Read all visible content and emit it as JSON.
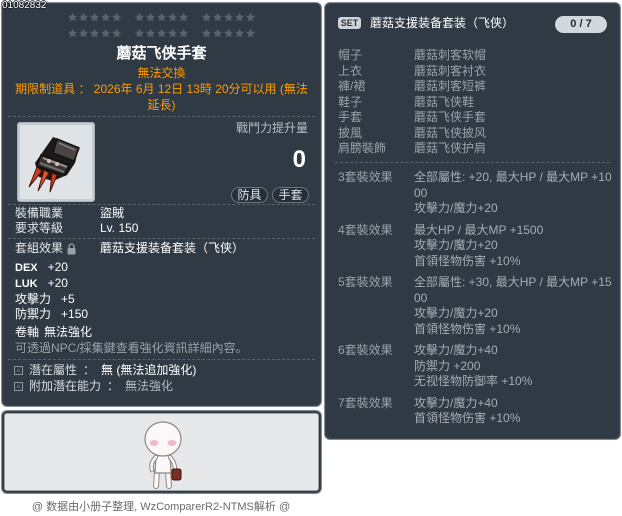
{
  "item_id": "01082832",
  "stars": {
    "total": 30,
    "filled": 0,
    "per_group": 5,
    "groups_per_row": 3
  },
  "colors": {
    "warning": "#ff9c00",
    "dimmed": "#9ba2a8",
    "panel": "#2f3a44"
  },
  "item": {
    "name": "蘑菇飞侠手套",
    "trade": "無法交換",
    "expiry": "期限制道具 ： 2026年 6月 12日 13時 20分可以用 (無法延長)",
    "icon": "glove-icon",
    "power_label": "戰鬥力提升量",
    "power_value": "0",
    "tags": [
      "防具",
      "手套"
    ]
  },
  "requirements": [
    {
      "label": "裝備職業",
      "value": "盜賊"
    },
    {
      "label": "要求等級",
      "value": "Lv. 150"
    }
  ],
  "set_effect": {
    "label": "套組效果",
    "icon": "lock-icon",
    "name": "蘑菇支援装备套装（飞侠）"
  },
  "stats": [
    {
      "label": "DEX",
      "value": "+20"
    },
    {
      "label": "LUK",
      "value": "+20"
    },
    {
      "label": "攻擊力",
      "value": "+5"
    },
    {
      "label": "防禦力",
      "value": "+150"
    }
  ],
  "scroll": {
    "label": "卷軸",
    "value": "無法強化"
  },
  "note": "可透過NPC/採集鍵查看強化資訊詳細內容。",
  "potential": [
    {
      "icon": "potential-bullet-icon",
      "label": "潛在屬性",
      "sep": "：",
      "value": "無 (無法追加強化)"
    },
    {
      "icon": "potential-bullet-icon",
      "label": "附加潛在能力",
      "sep": "：",
      "value": "無法強化"
    }
  ],
  "preview": {
    "sprite": "character-sprite"
  },
  "set_panel": {
    "badge": "SET",
    "title": "蘑菇支援装备套装（飞侠）",
    "counter": "0 / 7",
    "pieces": [
      {
        "slot": "帽子",
        "name": "蘑菇刺客软帽"
      },
      {
        "slot": "上衣",
        "name": "蘑菇刺客衬衣"
      },
      {
        "slot": "褲/裙",
        "name": "蘑菇刺客短裤"
      },
      {
        "slot": "鞋子",
        "name": "蘑菇飞侠鞋"
      },
      {
        "slot": "手套",
        "name": "蘑菇飞侠手套"
      },
      {
        "slot": "披風",
        "name": "蘑菇飞侠披风"
      },
      {
        "slot": "肩膀裝飾",
        "name": "蘑菇飞侠护肩"
      }
    ],
    "effects": [
      {
        "label": "3套裝效果",
        "lines": [
          "全部屬性: +20, 最大HP / 最大MP +1000",
          "攻擊力/魔力+20"
        ]
      },
      {
        "label": "4套裝效果",
        "lines": [
          "最大HP / 最大MP +1500",
          "攻擊力/魔力+20",
          "首領怪物伤害 +10%"
        ]
      },
      {
        "label": "5套裝效果",
        "lines": [
          "全部屬性: +30, 最大HP / 最大MP +1500",
          "攻擊力/魔力+20",
          "首領怪物伤害 +10%"
        ]
      },
      {
        "label": "6套裝效果",
        "lines": [
          "攻擊力/魔力+40",
          "防禦力 +200",
          "无视怪物防御率 +10%"
        ]
      },
      {
        "label": "7套裝效果",
        "lines": [
          "攻擊力/魔力+40",
          "首領怪物伤害 +10%"
        ]
      }
    ]
  },
  "footer": "@ 数据由小册子整理, WzComparerR2-NTMS解析 @"
}
